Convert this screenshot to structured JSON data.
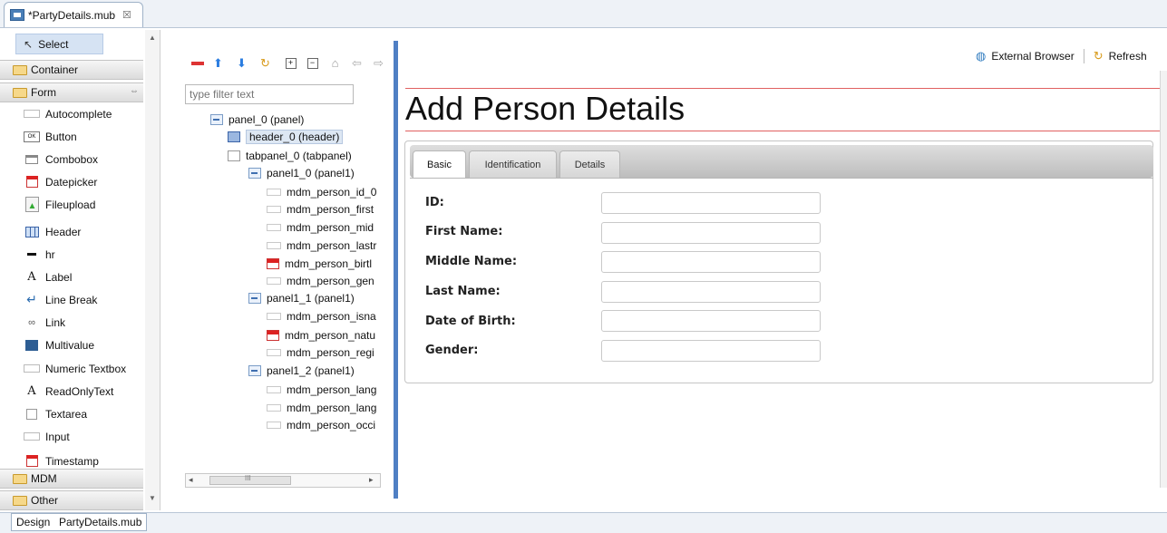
{
  "editor": {
    "tab_label": "*PartyDetails.mub",
    "close": "☒"
  },
  "palette": {
    "select": "Select",
    "categories": {
      "container": "Container",
      "form": "Form",
      "mdm": "MDM",
      "other": "Other"
    },
    "form_collapse": "⇔",
    "items": [
      "Autocomplete",
      "Button",
      "Combobox",
      "Datepicker",
      "Fileupload",
      "Header",
      "hr",
      "Label",
      "Line Break",
      "Link",
      "Multivalue",
      "Numeric Textbox",
      "ReadOnlyText",
      "Textarea",
      "Input",
      "Timestamp"
    ]
  },
  "outline": {
    "filter_placeholder": "type filter text",
    "tree": [
      "panel_0 (panel)",
      "header_0 (header)",
      "tabpanel_0 (tabpanel)",
      "panel1_0 (panel1)",
      "mdm_person_id_0",
      "mdm_person_first",
      "mdm_person_mid",
      "mdm_person_lastr",
      "mdm_person_birtl",
      "mdm_person_gen",
      "panel1_1 (panel1)",
      "mdm_person_isna",
      "mdm_person_natu",
      "mdm_person_regi",
      "panel1_2 (panel1)",
      "mdm_person_lang",
      "mdm_person_lang",
      "mdm_person_occi"
    ],
    "hscroll_grip": "III"
  },
  "preview": {
    "toolbar": {
      "external_browser": "External Browser",
      "refresh": "Refresh"
    },
    "title": "Add Person Details",
    "tabs": [
      "Basic",
      "Identification",
      "Details"
    ],
    "fields": [
      {
        "label": "ID:",
        "value": ""
      },
      {
        "label": "First Name:",
        "value": ""
      },
      {
        "label": "Middle Name:",
        "value": ""
      },
      {
        "label": "Last Name:",
        "value": ""
      },
      {
        "label": "Date of Birth:",
        "value": ""
      },
      {
        "label": "Gender:",
        "value": ""
      }
    ]
  },
  "bottom_tabs": [
    "Design",
    "PartyDetails.mub"
  ]
}
